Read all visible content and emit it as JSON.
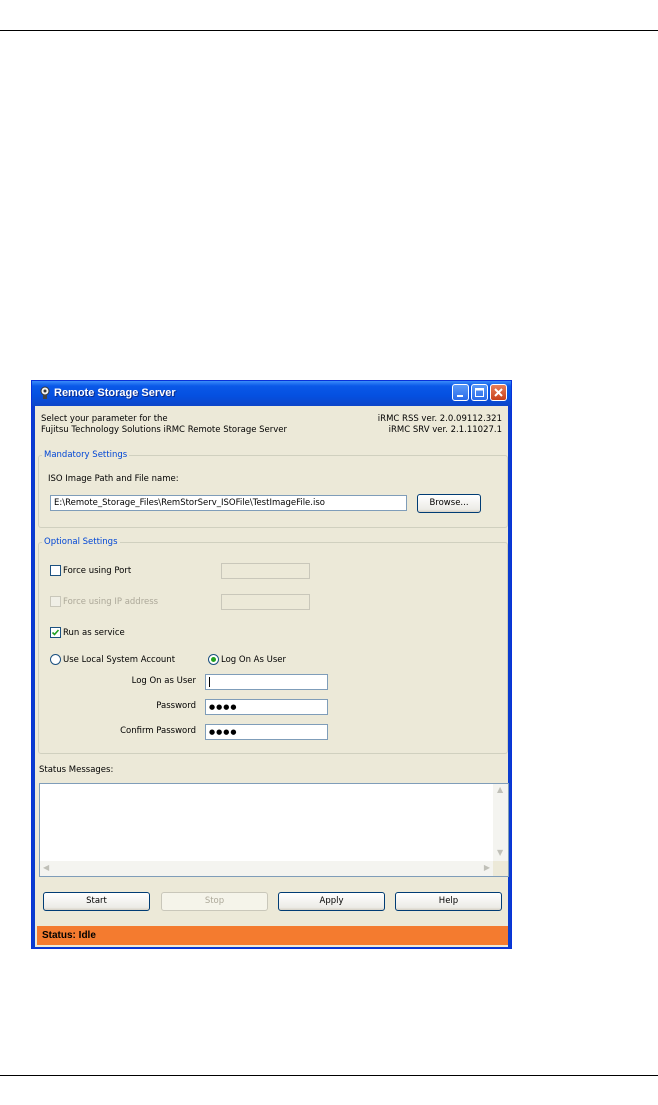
{
  "window": {
    "title": "Remote Storage Server"
  },
  "header": {
    "line1": "Select your parameter for the",
    "line2": "Fujitsu Technology Solutions iRMC Remote Storage Server",
    "version1": "iRMC RSS ver. 2.0.09112.321",
    "version2": "iRMC SRV ver. 2.1.11027.1"
  },
  "mandatory": {
    "legend": "Mandatory Settings",
    "iso_label": "ISO Image Path and File name:",
    "iso_value": "E:\\Remote_Storage_Files\\RemStorServ_ISOFile\\TestImageFile.iso",
    "browse_label": "Browse..."
  },
  "optional": {
    "legend": "Optional Settings",
    "force_port_label": "Force using Port",
    "force_port_checked": false,
    "force_ip_label": "Force using IP address",
    "force_ip_checked": false,
    "run_service_label": "Run as service",
    "run_service_checked": true,
    "local_system_label": "Use Local System Account",
    "log_on_user_radio_label": "Log On As User",
    "selected_account": "Log On As User",
    "logon_user_label": "Log On as User",
    "logon_user_value": "",
    "password_label": "Password",
    "password_value": "●●●●",
    "confirm_label": "Confirm Password",
    "confirm_value": "●●●●"
  },
  "status_messages": {
    "label": "Status Messages:"
  },
  "buttons": {
    "start": "Start",
    "stop": "Stop",
    "apply": "Apply",
    "help": "Help"
  },
  "statusbar": {
    "text": "Status: Idle",
    "color": "#f47b2f"
  },
  "colors": {
    "titlebar": "#0550e0",
    "legend_text": "#0046d5",
    "dialog_bg": "#ece9d8"
  }
}
